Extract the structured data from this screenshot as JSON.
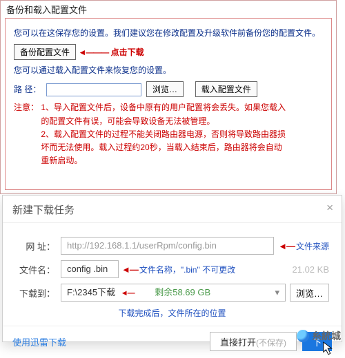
{
  "panel": {
    "tab": "备份和载入配置文件",
    "text1": "您可以在这保存您的设置。我们建议您在修改配置及升级软件前备份您的配置文件。",
    "backup_btn": "备份配置文件",
    "ann_download": "点击下载",
    "text2": "您可以通过载入配置文件来恢复您的设置。",
    "path_label": "路 径：",
    "browse_btn": "浏览…",
    "load_btn": "载入配置文件",
    "notice_label": "注意：",
    "notice_text": "1、导入配置文件后，设备中原有的用户配置将会丢失。如果您载入的配置文件有误，可能会导致设备无法被管理。\n2、载入配置文件的过程不能关闭路由器电源，否则将导致路由器损坏而无法使用。载入过程约20秒，当载入结束后，路由器将会自动重新启动。"
  },
  "dialog": {
    "title": "新建下载任务",
    "url_label": "网   址：",
    "url_value": "http://192.168.1.1/userRpm/config.bin",
    "ann_src": "文件来源",
    "name_label": "文件名：",
    "name_value": "config .bin",
    "ann_name": "文件名称，\".bin\" 不可更改",
    "size": "21.02 KB",
    "dest_label": "下载到：",
    "dest_value": "F:\\2345下载",
    "dest_free": "剩余58.69 GB",
    "browse": "浏览…",
    "ann_dest": "下载完成后，文件所在的位置",
    "thunder": "使用迅雷下载",
    "open_btn": "直接打开",
    "open_mut": "(不保存)",
    "download_btn": "下"
  },
  "watermark": "糸統城",
  "arrows": {
    "left": "◄———",
    "left2": "◄—",
    "right": "——►"
  }
}
